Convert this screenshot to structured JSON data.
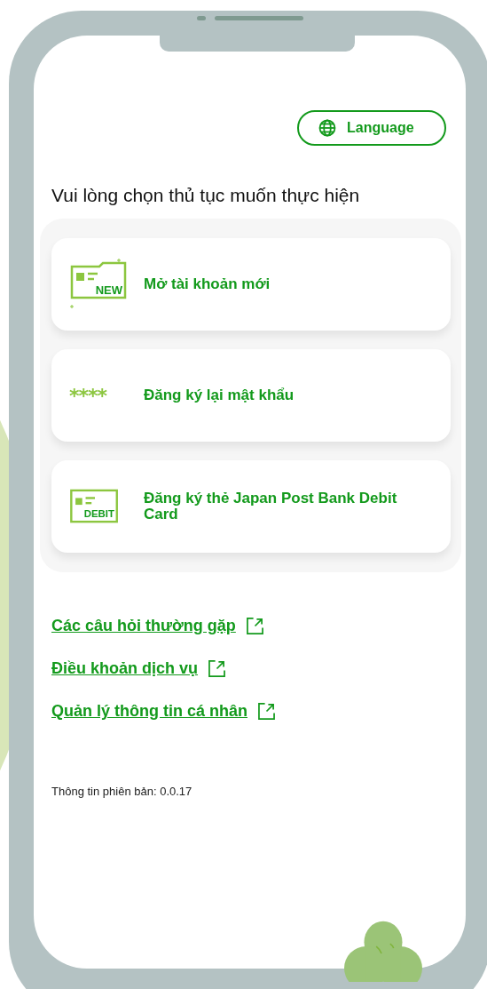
{
  "language_button": {
    "label": "Language"
  },
  "heading": "Vui lòng chọn thủ tục muốn thực hiện",
  "procedures": [
    {
      "kind": "new",
      "icon_text": "NEW",
      "label": "Mở tài khoản mới"
    },
    {
      "kind": "password",
      "icon_text": "****",
      "label": "Đăng ký lại mật khẩu"
    },
    {
      "kind": "debit",
      "icon_text": "DEBIT",
      "label": "Đăng ký thẻ Japan Post Bank Debit Card"
    }
  ],
  "links": [
    {
      "label": "Các câu hỏi thường gặp"
    },
    {
      "label": "Điều khoản dịch vụ"
    },
    {
      "label": "Quản lý thông tin cá nhân"
    }
  ],
  "version": "Thông tin phiên bản: 0.0.17"
}
